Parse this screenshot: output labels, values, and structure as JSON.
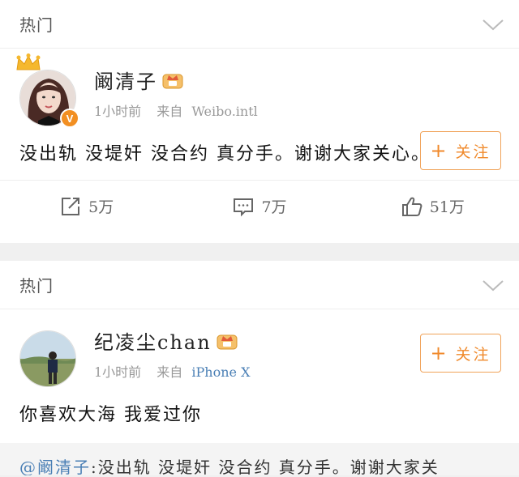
{
  "section_title": "热门",
  "posts": [
    {
      "username": "阚清子",
      "time": "1小时前",
      "source_prefix": "来自",
      "source": "Weibo.intl",
      "follow_label": "关注",
      "text": "没出轨 没堤奸 没合约 真分手。谢谢大家关心。",
      "repost_count": "5万",
      "comment_count": "7万",
      "like_count": "51万",
      "badge": "V"
    },
    {
      "username": "纪凌尘chan",
      "time": "1小时前",
      "source_prefix": "来自",
      "source": "iPhone X",
      "follow_label": "关注",
      "text": "你喜欢大海 我爱过你"
    }
  ],
  "quote": {
    "mention": "@阚清子",
    "text": ":没出轨 没堤奸 没合约 真分手。谢谢大家关"
  },
  "colors": {
    "accent": "#f08a2c",
    "link": "#4a7fb5",
    "badge": "#f28f22"
  }
}
